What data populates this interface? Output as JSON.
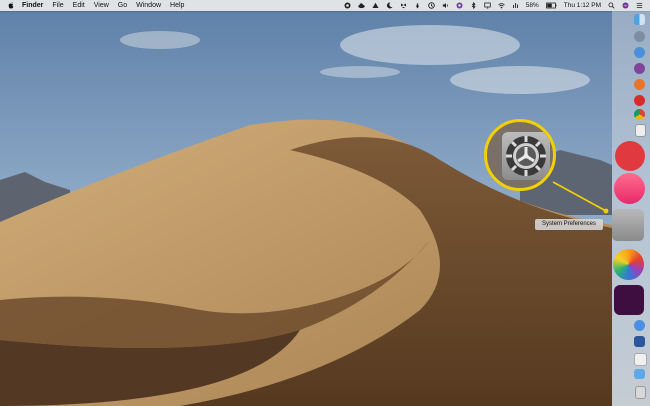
{
  "menubar": {
    "app_name": "Finder",
    "menus": [
      "File",
      "Edit",
      "View",
      "Go",
      "Window",
      "Help"
    ],
    "status_icons": [
      "creative-cloud-icon",
      "cloud-icon",
      "drive-icon",
      "moon-icon",
      "dropbox-icon",
      "pen-icon",
      "time-machine-icon",
      "volume-icon",
      "tor-icon",
      "bluetooth-icon",
      "cast-icon",
      "wifi-icon",
      "audio-icon"
    ],
    "battery_percent": "58%",
    "clock": "Thu 1:12 PM"
  },
  "tooltip": {
    "text": "System Preferences"
  },
  "highlight_color": "#f4d000",
  "dock": {
    "items": [
      "finder-icon",
      "launchpad-icon",
      "safari-icon",
      "tor-browser-icon",
      "firefox-icon",
      "opera-icon",
      "chrome-icon",
      "notes-icon",
      "news-icon",
      "music-icon",
      "system-preferences-icon",
      "photos-icon",
      "slack-icon",
      "messages-icon",
      "word-icon",
      "trash-icon"
    ]
  }
}
